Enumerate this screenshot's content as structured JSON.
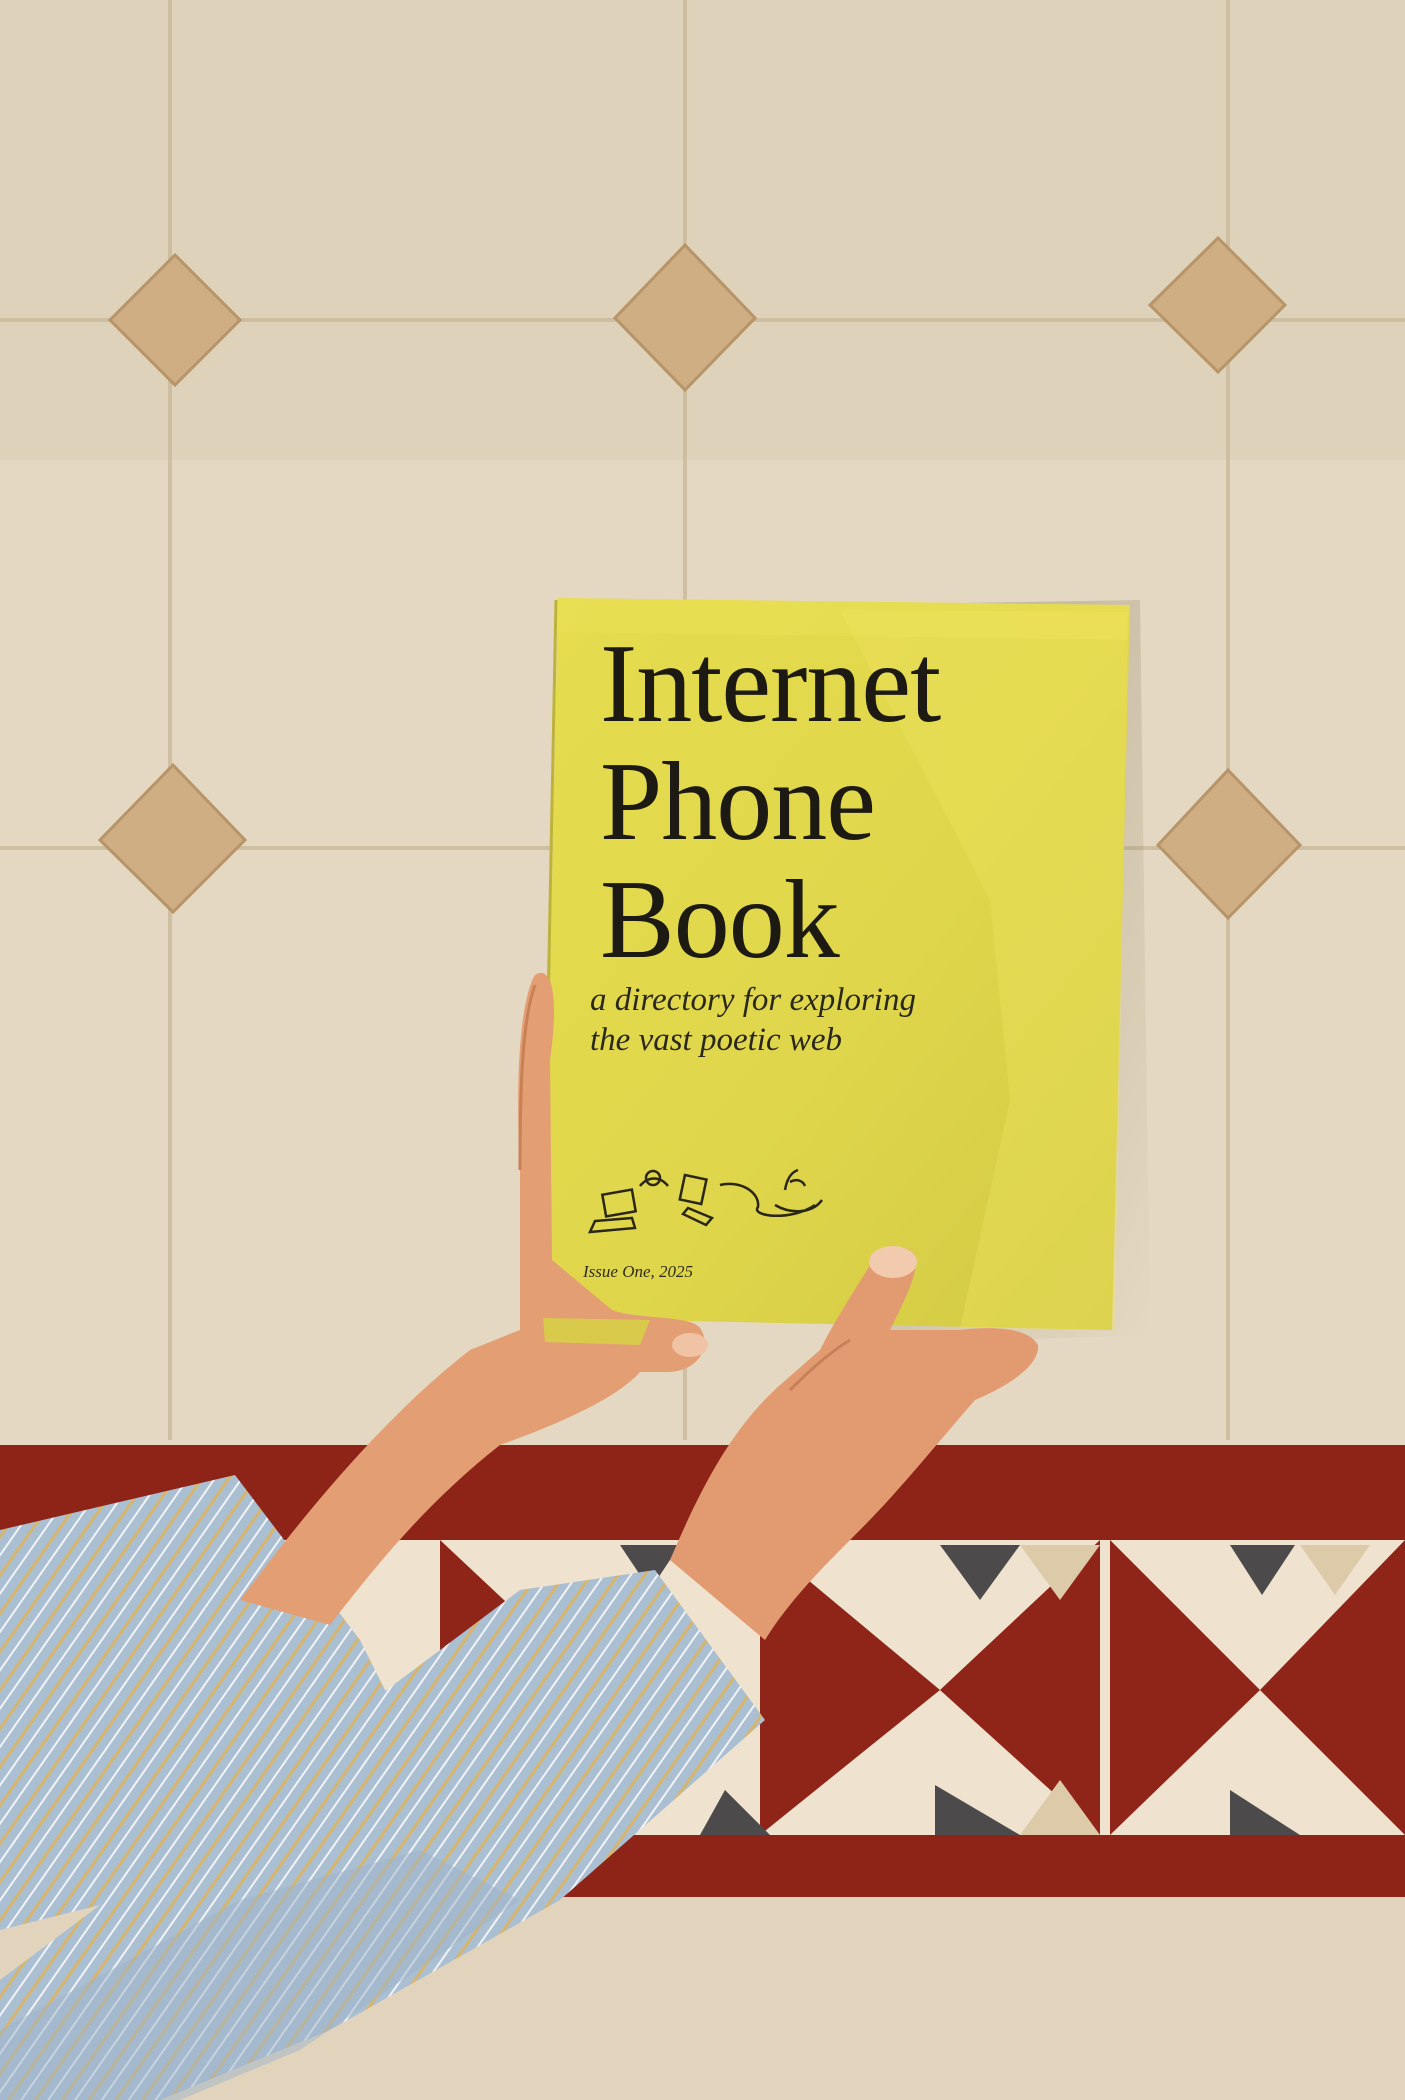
{
  "book": {
    "title_line_1": "Internet",
    "title_line_2": "Phone",
    "title_line_3": "Book",
    "subtitle_line_1": "a directory for exploring",
    "subtitle_line_2": "the vast poetic web",
    "issue": "Issue One, 2025",
    "cover_color": "#e2d84a"
  },
  "scene": {
    "wall_color": "#e3d6c0",
    "border_red": "#8e2318",
    "shirt_color": "#a9bdcf",
    "skin_color": "#e09a72"
  }
}
